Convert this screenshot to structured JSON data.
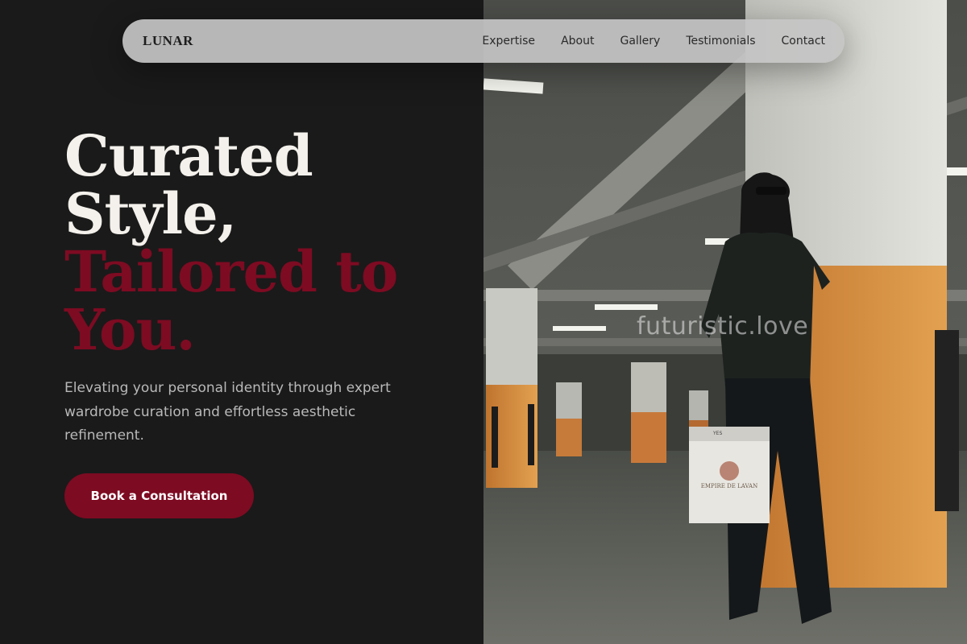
{
  "nav": {
    "logo": "LUNAR",
    "links": [
      {
        "label": "Expertise"
      },
      {
        "label": "About"
      },
      {
        "label": "Gallery"
      },
      {
        "label": "Testimonials"
      },
      {
        "label": "Contact"
      }
    ]
  },
  "hero": {
    "headline_line1": "Curated",
    "headline_line2": "Style,",
    "headline_line3": "Tailored to",
    "headline_line4": "You.",
    "subtext": "Elevating your personal identity through expert wardrobe curation and effortless aesthetic refinement.",
    "cta_label": "Book a Consultation"
  },
  "photo": {
    "watermark": "futuristic.love",
    "bag_text": "EMPIRE DE LAVAN",
    "bag_tag": "YES"
  },
  "colors": {
    "background": "#1a1a1a",
    "accent": "#7d0b22",
    "headline": "#f4f1ec",
    "nav_bg": "#c4c4c4"
  }
}
